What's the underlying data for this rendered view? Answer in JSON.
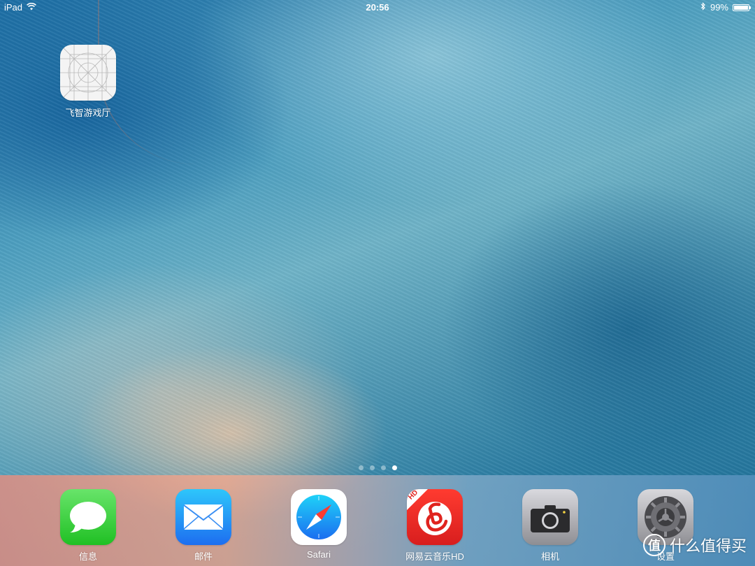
{
  "status_bar": {
    "device": "iPad",
    "time": "20:56",
    "battery_percent": "99%",
    "battery_level": 0.99,
    "icons": [
      "wifi-icon",
      "bluetooth-icon",
      "battery-icon"
    ]
  },
  "home": {
    "apps": [
      {
        "label": "飞智游戏厅",
        "icon": "placeholder-grid-icon"
      }
    ]
  },
  "page_indicator": {
    "total": 4,
    "active_index": 3
  },
  "dock": {
    "apps": [
      {
        "label": "信息",
        "icon": "messages-icon"
      },
      {
        "label": "邮件",
        "icon": "mail-icon"
      },
      {
        "label": "Safari",
        "icon": "safari-icon"
      },
      {
        "label": "网易云音乐HD",
        "icon": "netease-music-icon",
        "badge_text": "HD"
      },
      {
        "label": "相机",
        "icon": "camera-icon"
      },
      {
        "label": "设置",
        "icon": "settings-gear-icon"
      }
    ]
  },
  "watermark": {
    "text": "什么值得买",
    "logo_glyph": "值"
  }
}
